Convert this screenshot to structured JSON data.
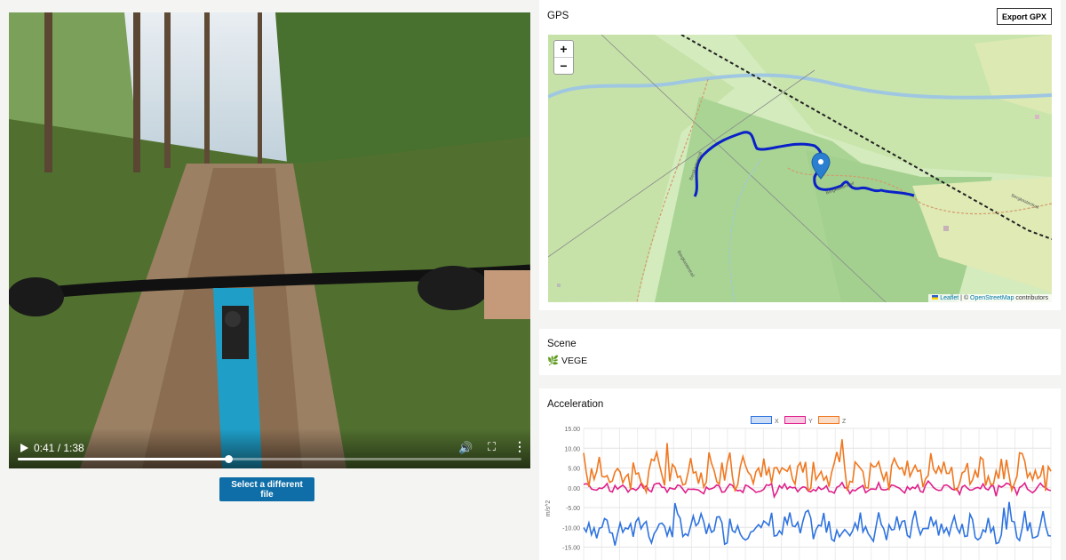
{
  "video": {
    "time": "0:41 / 1:38",
    "progress_fraction": 0.418,
    "select_label": "Select a different file"
  },
  "gps": {
    "title": "GPS",
    "export_label": "Export GPX",
    "zoom_in": "+",
    "zoom_out": "−",
    "map_labels": [
      "Bergkastentrail",
      "Bergkastentrail",
      "Bergkastentrail",
      "Bergkastentrail"
    ],
    "attribution_leaflet": "Leaflet",
    "attribution_sep": " | © ",
    "attribution_osm": "OpenStreetMap",
    "attribution_tail": " contributors"
  },
  "scene": {
    "title": "Scene",
    "icon": "leaf-icon",
    "value": "🌿 VEGE"
  },
  "acceleration": {
    "title": "Acceleration",
    "chart_data": {
      "type": "line",
      "ylabel": "m/s^2",
      "ylim": [
        -15,
        15
      ],
      "yticks": [
        "15.00",
        "10.00",
        "5.00",
        "0.00",
        "-5.00",
        "-10.00",
        "-15.00"
      ],
      "series": [
        {
          "name": "X",
          "color": "#2f73e0",
          "mean": -10,
          "amplitude": 3
        },
        {
          "name": "Y",
          "color": "#e0208a",
          "mean": 0,
          "amplitude": 1
        },
        {
          "name": "Z",
          "color": "#f07820",
          "mean": 4,
          "amplitude": 3.5
        }
      ]
    }
  }
}
